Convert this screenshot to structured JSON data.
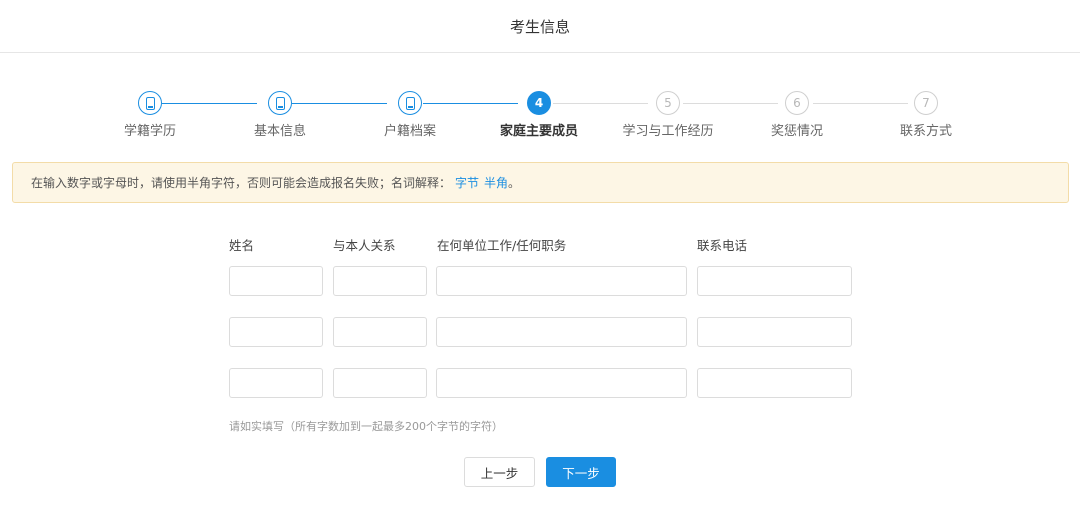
{
  "header": {
    "title": "考生信息"
  },
  "steps": [
    {
      "number": "1",
      "label": "学籍学历",
      "status": "done",
      "icon": "document-check-icon"
    },
    {
      "number": "2",
      "label": "基本信息",
      "status": "done",
      "icon": "document-check-icon"
    },
    {
      "number": "3",
      "label": "户籍档案",
      "status": "done",
      "icon": "document-check-icon"
    },
    {
      "number": "4",
      "label": "家庭主要成员",
      "status": "current"
    },
    {
      "number": "5",
      "label": "学习与工作经历",
      "status": "todo"
    },
    {
      "number": "6",
      "label": "奖惩情况",
      "status": "todo"
    },
    {
      "number": "7",
      "label": "联系方式",
      "status": "todo"
    }
  ],
  "notice": {
    "text": "在输入数字或字母时，请使用半角字符，否则可能会造成报名失败；名词解释：",
    "link_byte": "字节",
    "link_halfwidth": "半角",
    "end": "。"
  },
  "form": {
    "columns": {
      "name": "姓名",
      "relation": "与本人关系",
      "work": "在何单位工作/任何职务",
      "phone": "联系电话"
    },
    "rows": [
      {
        "name": "",
        "relation": "",
        "work": "",
        "phone": ""
      },
      {
        "name": "",
        "relation": "",
        "work": "",
        "phone": ""
      },
      {
        "name": "",
        "relation": "",
        "work": "",
        "phone": ""
      }
    ],
    "hint": "请如实填写（所有字数加到一起最多200个字节的字符）"
  },
  "buttons": {
    "prev": "上一步",
    "next": "下一步"
  },
  "colors": {
    "accent": "#1a8ee1",
    "notice_bg": "#fdf6e5",
    "notice_border": "#f3dca8"
  }
}
